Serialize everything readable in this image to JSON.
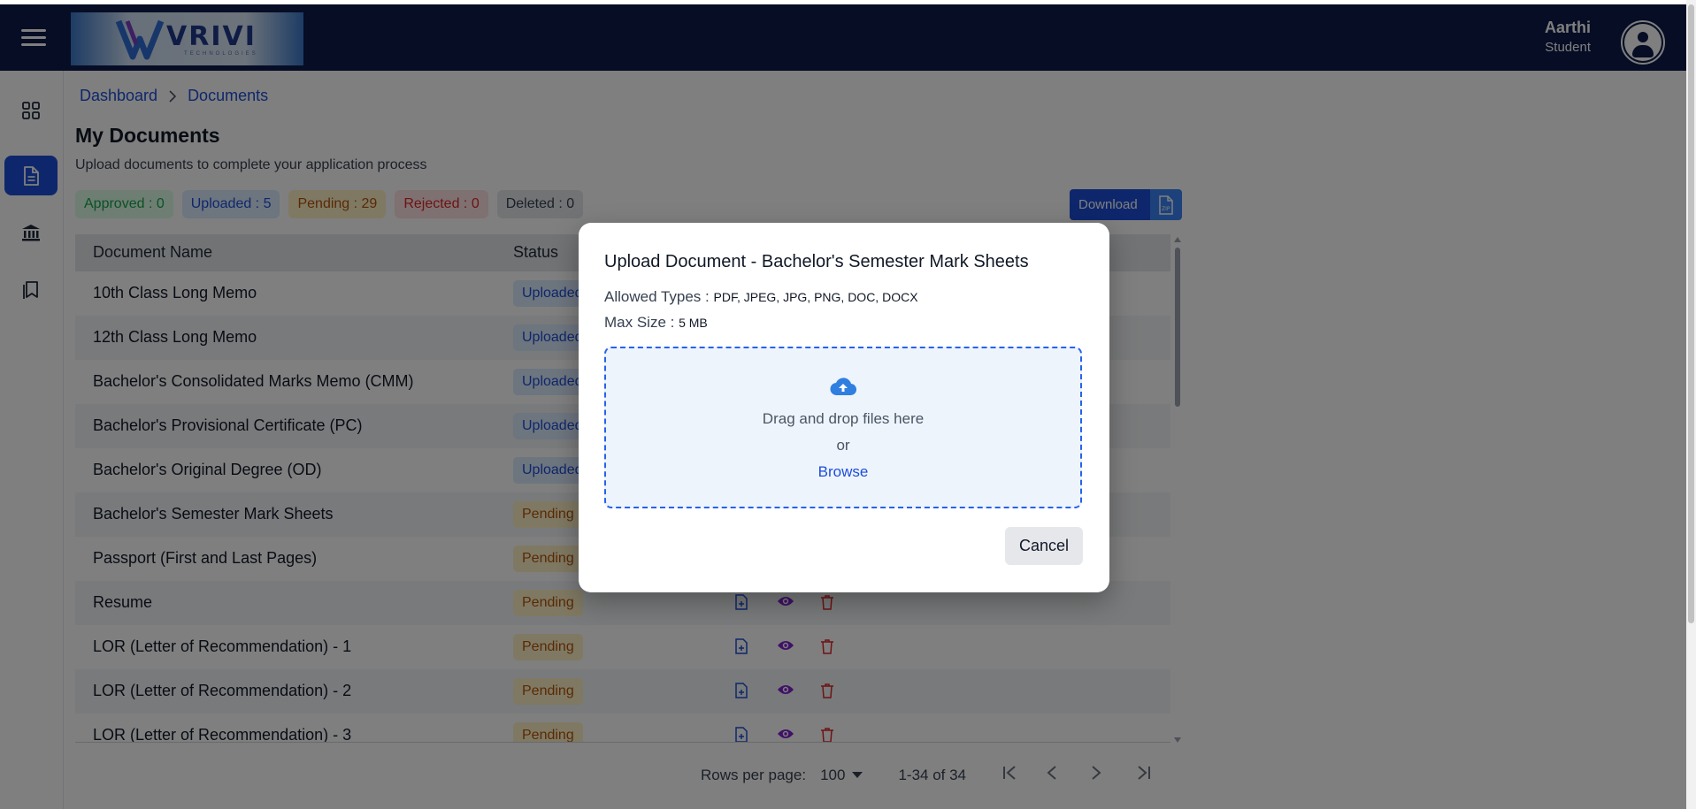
{
  "header": {
    "logo_text": "VRIVI",
    "logo_sub": "TECHNOLOGIES",
    "user_name": "Aarthi",
    "user_role": "Student"
  },
  "breadcrumb": {
    "home": "Dashboard",
    "current": "Documents"
  },
  "page": {
    "title": "My Documents",
    "subtitle": "Upload documents to complete your application process"
  },
  "badges": {
    "approved": "Approved : 0",
    "uploaded": "Uploaded : 5",
    "pending": "Pending : 29",
    "rejected": "Rejected : 0",
    "deleted": "Deleted : 0"
  },
  "download_label": "Download",
  "table": {
    "headers": {
      "name": "Document Name",
      "status": "Status"
    },
    "rows": [
      {
        "name": "10th Class Long Memo",
        "status": "Uploaded"
      },
      {
        "name": "12th Class Long Memo",
        "status": "Uploaded"
      },
      {
        "name": "Bachelor's Consolidated Marks Memo (CMM)",
        "status": "Uploaded"
      },
      {
        "name": "Bachelor's Provisional Certificate (PC)",
        "status": "Uploaded"
      },
      {
        "name": "Bachelor's Original Degree (OD)",
        "status": "Uploaded"
      },
      {
        "name": "Bachelor's Semester Mark Sheets",
        "status": "Pending"
      },
      {
        "name": "Passport (First and Last Pages)",
        "status": "Pending"
      },
      {
        "name": "Resume",
        "status": "Pending"
      },
      {
        "name": "LOR (Letter of Recommendation) - 1",
        "status": "Pending"
      },
      {
        "name": "LOR (Letter of Recommendation) - 2",
        "status": "Pending"
      },
      {
        "name": "LOR (Letter of Recommendation) - 3",
        "status": "Pending"
      }
    ]
  },
  "pagination": {
    "rows_label": "Rows per page:",
    "rows_value": "100",
    "range": "1-34 of 34"
  },
  "modal": {
    "title": "Upload Document - Bachelor's Semester Mark Sheets",
    "allowed_label": "Allowed Types :",
    "allowed_value": "PDF, JPEG, JPG, PNG, DOC, DOCX",
    "size_label": "Max Size :",
    "size_value": "5 MB",
    "drag_text": "Drag and drop files here",
    "or_text": "or",
    "browse_text": "Browse",
    "cancel_label": "Cancel"
  },
  "colors": {
    "header_bg": "#0d1b4b",
    "primary": "#1d4ed8",
    "pending": "#b45309",
    "action_view": "#7e22ce",
    "action_delete": "#dc2626"
  }
}
